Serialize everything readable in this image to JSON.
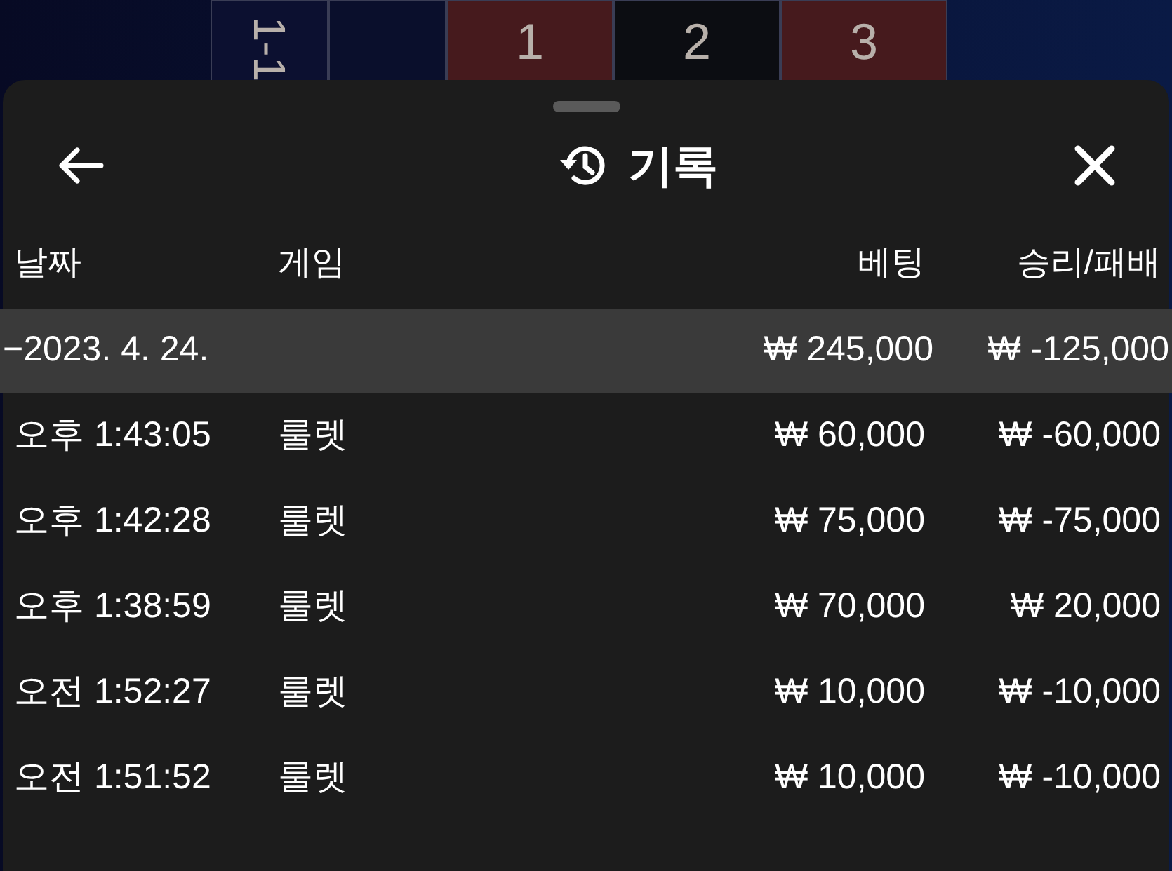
{
  "board": {
    "cells": [
      {
        "label": "1-1",
        "color": "#0c1030"
      },
      {
        "color": "#0a0f2c"
      },
      {
        "label": "1",
        "color": "#461a1d"
      },
      {
        "label": "2",
        "color": "#0c0d12"
      },
      {
        "label": "3",
        "color": "#461a1d"
      }
    ]
  },
  "sheet": {
    "title": "기록"
  },
  "table": {
    "columns": [
      "날짜",
      "게임",
      "베팅",
      "승리/패배"
    ],
    "date_group": {
      "date": "−2023. 4. 24.",
      "bet": "₩ 245,000",
      "result": "₩ -125,000"
    },
    "rows": [
      {
        "time": "오후 1:43:05",
        "game": "룰렛",
        "bet": "₩ 60,000",
        "result": "₩ -60,000"
      },
      {
        "time": "오후 1:42:28",
        "game": "룰렛",
        "bet": "₩ 75,000",
        "result": "₩ -75,000"
      },
      {
        "time": "오후 1:38:59",
        "game": "룰렛",
        "bet": "₩ 70,000",
        "result": "₩ 20,000"
      },
      {
        "time": "오전 1:52:27",
        "game": "룰렛",
        "bet": "₩ 10,000",
        "result": "₩ -10,000"
      },
      {
        "time": "오전 1:51:52",
        "game": "룰렛",
        "bet": "₩ 10,000",
        "result": "₩ -10,000"
      }
    ]
  }
}
